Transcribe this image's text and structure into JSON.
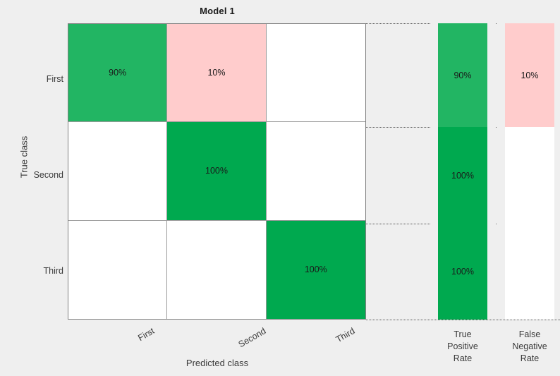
{
  "chart_data": {
    "type": "heatmap",
    "title": "Model 1",
    "xlabel": "Predicted class",
    "ylabel": "True class",
    "classes": [
      "First",
      "Second",
      "Third"
    ],
    "x_tick_labels": [
      "First",
      "Second",
      "Third"
    ],
    "y_tick_labels": [
      "First",
      "Second",
      "Third"
    ],
    "cell_unit": "%",
    "matrix_display": [
      [
        "90%",
        "10%",
        ""
      ],
      [
        "",
        "100%",
        ""
      ],
      [
        "",
        "",
        "100%"
      ]
    ],
    "matrix_values": [
      [
        90,
        10,
        null
      ],
      [
        null,
        100,
        null
      ],
      [
        null,
        null,
        100
      ]
    ],
    "cell_kind": [
      [
        "correct",
        "incorrect",
        "empty"
      ],
      [
        "empty",
        "correct",
        "empty"
      ],
      [
        "empty",
        "empty",
        "correct"
      ]
    ],
    "summary_columns": [
      {
        "key": "true_positive_rate",
        "caption_lines": [
          "True",
          "Positive",
          "Rate"
        ],
        "kind": "correct",
        "display_values": [
          "90%",
          "100%",
          "100%"
        ],
        "values": [
          90,
          100,
          100
        ]
      },
      {
        "key": "false_negative_rate",
        "caption_lines": [
          "False",
          "Negative",
          "Rate"
        ],
        "kind": "incorrect",
        "display_values": [
          "10%",
          "",
          ""
        ],
        "values": [
          10,
          null,
          null
        ]
      }
    ],
    "colors": {
      "background": "#efefef",
      "cell_correct_strong": "#00a94f",
      "cell_correct_light": "#22b563",
      "cell_incorrect": "#ffcccc",
      "cell_empty": "#ffffff",
      "grid_line": "#9a9a9a",
      "axis_border": "#808080",
      "text": "#1a1a1a",
      "axis_text": "#3a3a3a",
      "leader_line": "#555555"
    },
    "legend_position": "none",
    "grid": true
  }
}
